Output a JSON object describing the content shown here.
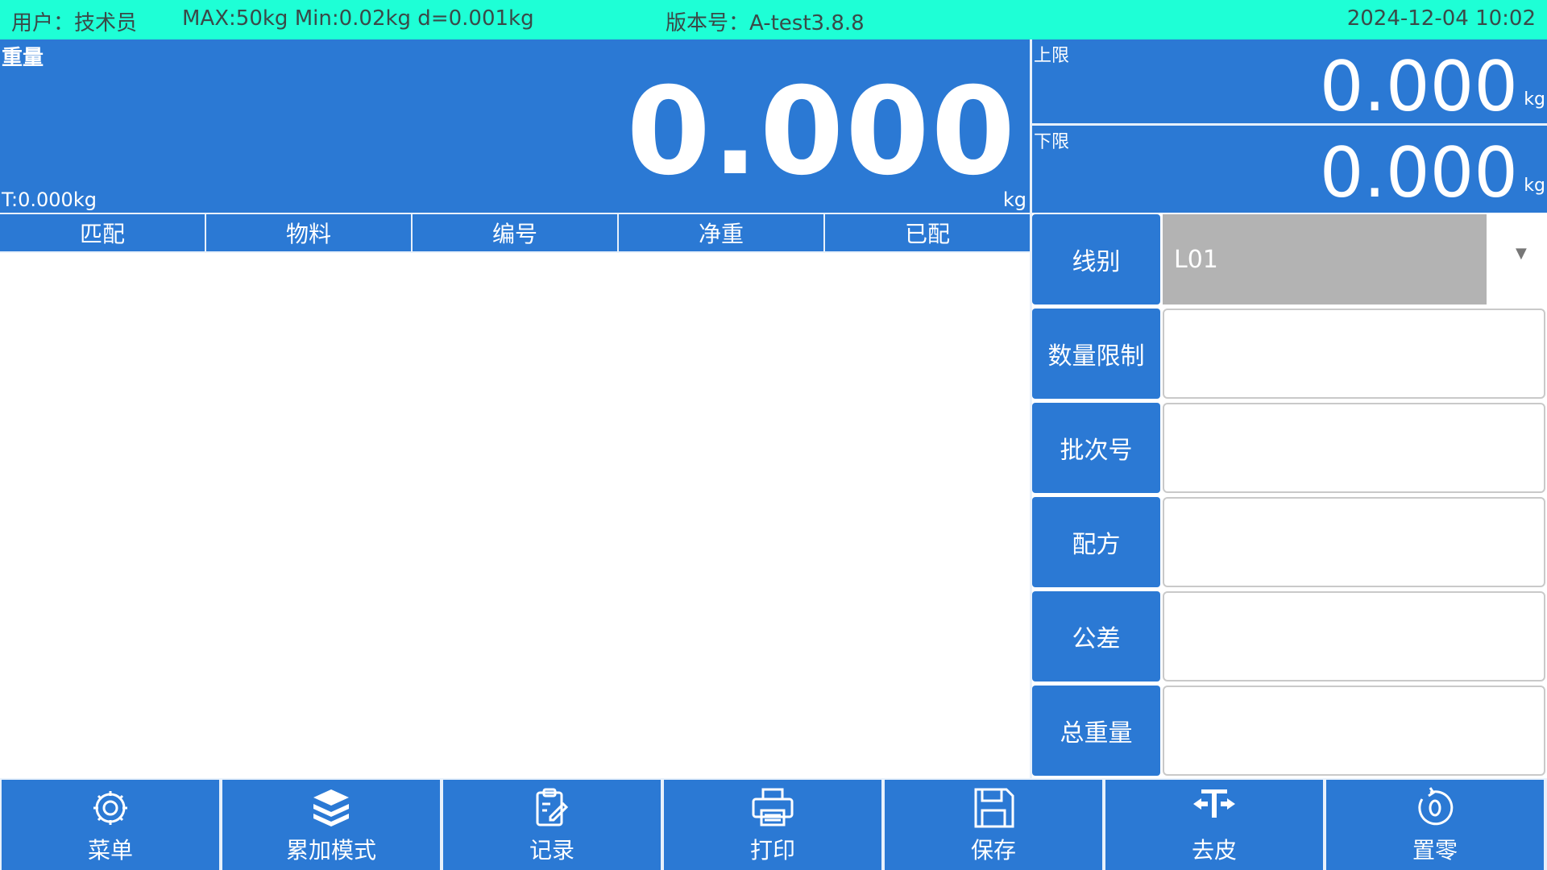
{
  "status": {
    "user": "用户：技术员",
    "spec": "MAX:50kg Min:0.02kg d=0.001kg",
    "version": "版本号：A-test3.8.8",
    "datetime": "2024-12-04 10:02"
  },
  "weight": {
    "label": "重量",
    "value": "0.000",
    "tare": "T:0.000kg",
    "unit": "kg"
  },
  "limits": {
    "upper_label": "上限",
    "upper_value": "0.000",
    "upper_unit": "kg",
    "lower_label": "下限",
    "lower_value": "0.000",
    "lower_unit": "kg"
  },
  "table": {
    "columns": [
      "匹配",
      "物料",
      "编号",
      "净重",
      "已配"
    ]
  },
  "form": {
    "line_label": "线别",
    "line_value": "L01",
    "qty_limit_label": "数量限制",
    "batch_label": "批次号",
    "recipe_label": "配方",
    "tolerance_label": "公差",
    "total_weight_label": "总重量"
  },
  "toolbar": {
    "menu": "菜单",
    "accumulate": "累加模式",
    "record": "记录",
    "print": "打印",
    "save": "保存",
    "tare": "去皮",
    "zero": "置零"
  }
}
